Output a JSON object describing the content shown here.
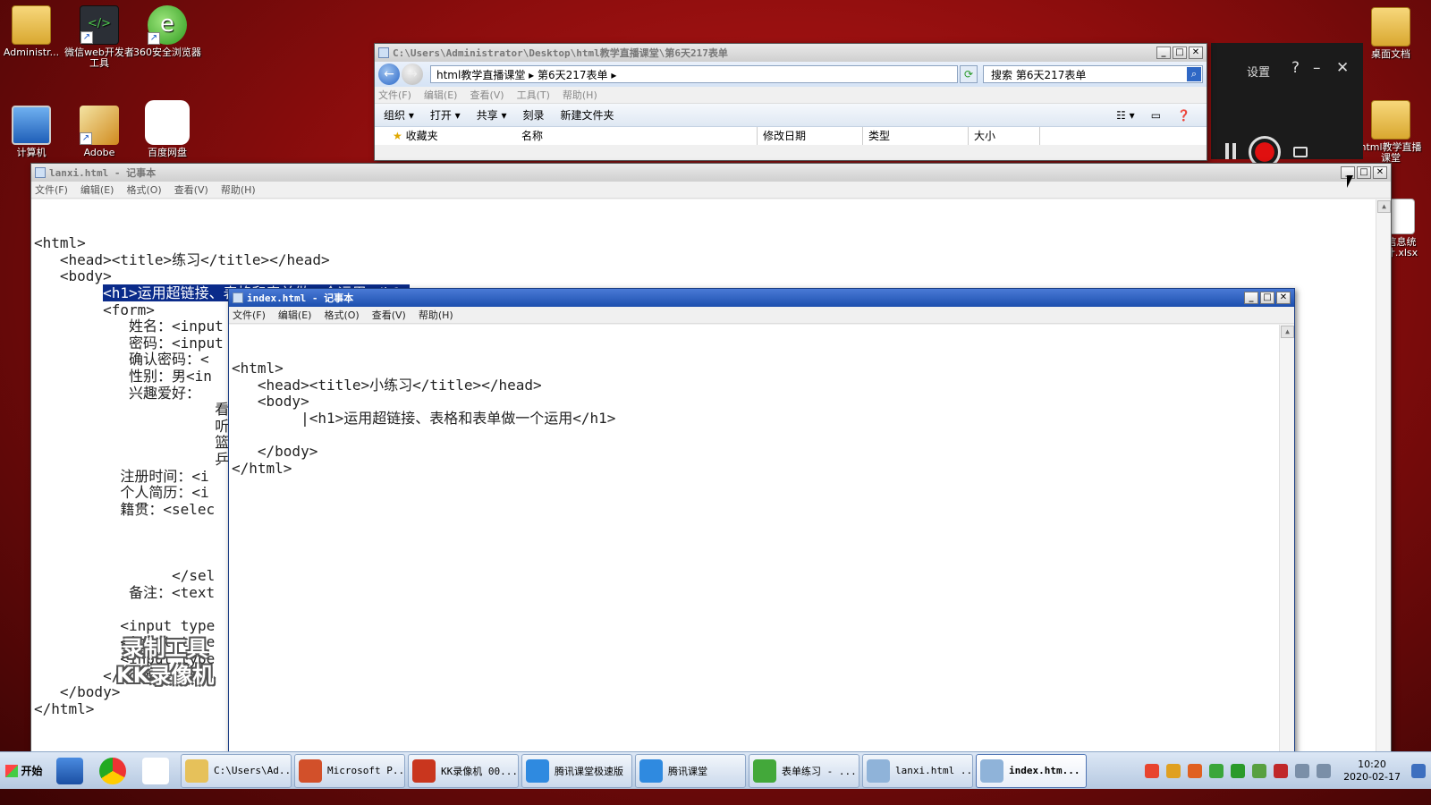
{
  "desktop_icons_left": [
    {
      "label": "Administr...",
      "icon": "user-folder-icon"
    },
    {
      "label": "微信web开发者工具",
      "icon": "wechat-dev-tools-icon"
    },
    {
      "label": "360安全浏览器",
      "icon": "360-browser-icon"
    },
    {
      "label": "计算机",
      "icon": "computer-icon"
    },
    {
      "label": "Adobe",
      "icon": "adobe-icon"
    },
    {
      "label": "百度网盘",
      "icon": "baidu-netdisk-icon"
    }
  ],
  "desktop_icons_right": [
    {
      "label": "桌面文档",
      "icon": "folder-icon"
    },
    {
      "label": "html教学直播课堂",
      "icon": "folder-icon"
    },
    {
      "label": "信息统计.xlsx",
      "icon": "file-icon"
    }
  ],
  "recorder_panel": {
    "settings": "设置",
    "help": "?",
    "minimize": "–",
    "close": "✕"
  },
  "explorer": {
    "title": "C:\\Users\\Administrator\\Desktop\\html教学直播课堂\\第6天217表单",
    "breadcrumb": "html教学直播课堂 ▸ 第6天217表单 ▸",
    "search_placeholder": "搜索 第6天217表单",
    "menu": [
      "文件(F)",
      "编辑(E)",
      "查看(V)",
      "工具(T)",
      "帮助(H)"
    ],
    "toolbar": [
      "组织 ▾",
      "打开 ▾",
      "共享 ▾",
      "刻录",
      "新建文件夹"
    ],
    "favorites": "收藏夹",
    "columns": [
      "名称",
      "修改日期",
      "类型",
      "大小"
    ]
  },
  "notepad_back": {
    "title": "lanxi.html - 记事本",
    "menu": [
      "文件(F)",
      "编辑(E)",
      "格式(O)",
      "查看(V)",
      "帮助(H)"
    ],
    "lines": [
      "<html>",
      "   <head><title>练习</title></head>",
      "   <body>",
      "        <h1>运用超链接、表格和表单做一个运用</h1>",
      "        <form>",
      "           姓名：<input",
      "           密码：<input",
      "           确认密码：<",
      "           性别：男<in",
      "           兴趣爱好：",
      "                     看",
      "                     听",
      "                     篮",
      "                     乒",
      "          注册时间：<i",
      "          个人简历：<i",
      "          籍贯：<selec",
      "",
      "",
      "",
      "                </sel",
      "           备注：<text",
      "",
      "          <input type",
      "          <input type",
      "          <input type",
      "        </form>",
      "   </body>",
      "</html>"
    ],
    "highlight_line": 3
  },
  "notepad_front": {
    "title": "index.html - 记事本",
    "menu": [
      "文件(F)",
      "编辑(E)",
      "格式(O)",
      "查看(V)",
      "帮助(H)"
    ],
    "lines": [
      "<html>",
      "   <head><title>小练习</title></head>",
      "   <body>",
      "        |<h1>运用超链接、表格和表单做一个运用</h1>",
      "",
      "   </body>",
      "</html>"
    ]
  },
  "watermark": {
    "line1": "录制工具",
    "line2": "KK录像机"
  },
  "taskbar": {
    "start": "开始",
    "buttons": [
      {
        "label": "C:\\Users\\Ad...",
        "color": "#e6c15a"
      },
      {
        "label": "Microsoft P...",
        "color": "#d2502a"
      },
      {
        "label": "KK录像机 00...",
        "color": "#c9361e"
      },
      {
        "label": "腾讯课堂极速版",
        "color": "#2f8ae0"
      },
      {
        "label": "腾讯课堂",
        "color": "#2f8ae0"
      },
      {
        "label": "表单练习 - ...",
        "color": "#43a83a"
      },
      {
        "label": "lanxi.html ...",
        "color": "#8fb3d9"
      },
      {
        "label": "index.htm...",
        "color": "#8fb3d9"
      }
    ],
    "time": "10:20",
    "date": "2020-02-17"
  }
}
